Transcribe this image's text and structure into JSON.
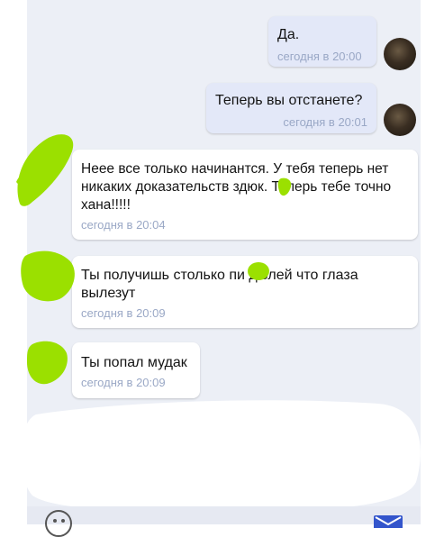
{
  "messages": [
    {
      "text": "Да.",
      "time": "сегодня в 20:00"
    },
    {
      "text": "Теперь вы отстанете?",
      "time": "сегодня в 20:01"
    },
    {
      "text": "Неее все только начинантся. У тебя теперь нет никаких доказательств     здюк. Теперь тебе точно хана!!!!!",
      "time": "сегодня в 20:04"
    },
    {
      "text": "Ты получишь столько пи   дюлей что глаза вылезут",
      "time": "сегодня в 20:09"
    },
    {
      "text": "Ты попал мудак",
      "time": "сегодня в 20:09"
    }
  ],
  "colors": {
    "outgoing_bubble": "#e3e8f8",
    "incoming_bubble": "#ffffff",
    "timestamp": "#9aa8c6",
    "scribble": "#9be000",
    "send_icon": "#3355cc"
  },
  "icons": [
    "emoji-icon",
    "send-icon"
  ]
}
